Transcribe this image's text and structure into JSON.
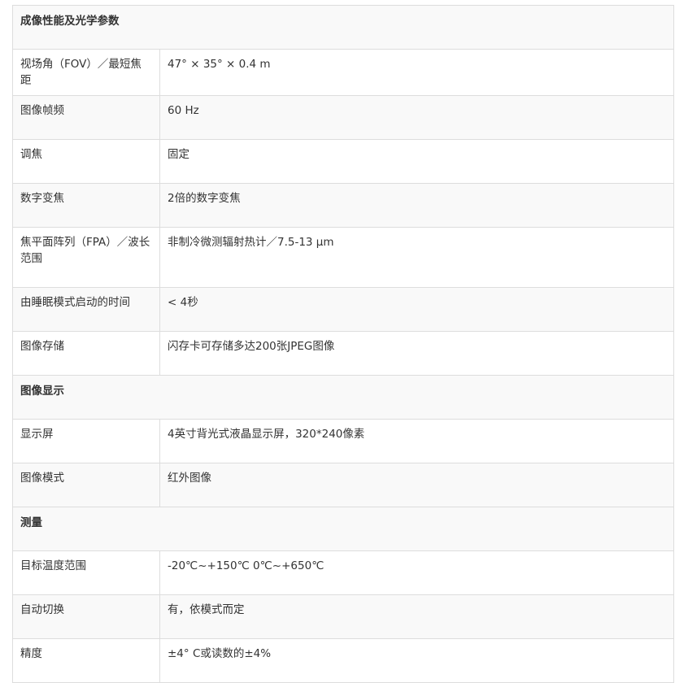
{
  "sections": [
    {
      "title": "成像性能及光学参数",
      "rows": [
        {
          "label": "视场角（FOV）／最短焦距",
          "value": "47° × 35° × 0.4 m"
        },
        {
          "label": "图像帧频",
          "value": "60 Hz"
        },
        {
          "label": "调焦",
          "value": "固定"
        },
        {
          "label": "数字变焦",
          "value": "2倍的数字变焦"
        },
        {
          "label": "焦平面阵列（FPA）／波长范围",
          "value": "非制冷微测辐射热计／7.5-13 μm"
        },
        {
          "label": "由睡眠模式启动的时间",
          "value": "< 4秒"
        },
        {
          "label": "图像存储",
          "value": "闪存卡可存储多达200张JPEG图像"
        }
      ]
    },
    {
      "title": "图像显示",
      "rows": [
        {
          "label": "显示屏",
          "value": "4英寸背光式液晶显示屏，320*240像素"
        },
        {
          "label": "图像模式",
          "value": "红外图像"
        }
      ]
    },
    {
      "title": "测量",
      "rows": [
        {
          "label": "目标温度范围",
          "value": "-20℃~+150℃ 0℃~+650℃"
        },
        {
          "label": "自动切换",
          "value": "有，依模式而定"
        },
        {
          "label": "精度",
          "value": "±4° C或读数的±4%"
        }
      ]
    }
  ]
}
